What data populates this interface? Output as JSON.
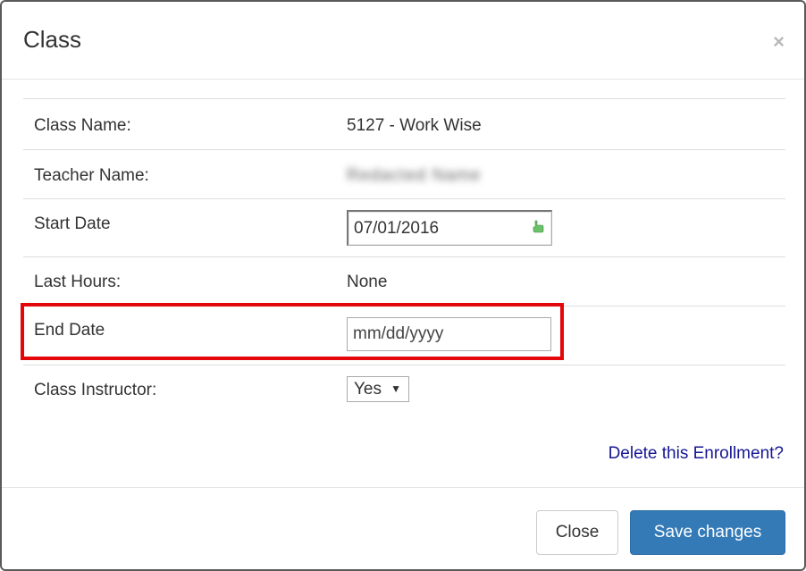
{
  "modal": {
    "title": "Class",
    "close_symbol": "×"
  },
  "form": {
    "class_name": {
      "label": "Class Name:",
      "value": "5127 - Work Wise"
    },
    "teacher_name": {
      "label": "Teacher Name:",
      "value": "Redacted Name"
    },
    "start_date": {
      "label": "Start Date",
      "value": "07/01/2016",
      "icon": "pointing-hand-icon"
    },
    "last_hours": {
      "label": "Last Hours:",
      "value": "None"
    },
    "end_date": {
      "label": "End Date",
      "placeholder": "mm/dd/yyyy"
    },
    "class_instructor": {
      "label": "Class Instructor:",
      "selected": "Yes",
      "caret": "▼"
    }
  },
  "links": {
    "delete": "Delete this Enrollment?"
  },
  "footer": {
    "close_label": "Close",
    "save_label": "Save changes"
  },
  "colors": {
    "primary": "#337ab7",
    "highlight": "#e3070b",
    "link": "#161694"
  }
}
